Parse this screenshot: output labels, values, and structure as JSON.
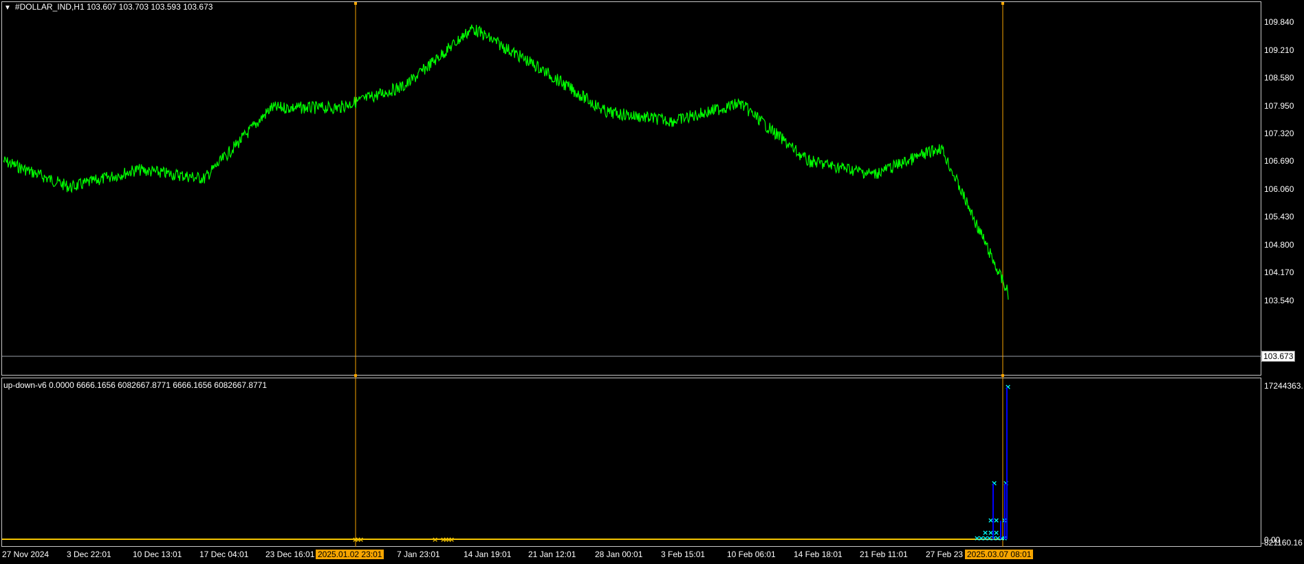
{
  "chart_data": [
    {
      "type": "line",
      "title": "#DOLLAR_IND,H1  103.607 103.703 103.593 103.673",
      "symbol": "#DOLLAR_IND",
      "timeframe": "H1",
      "ohlc": {
        "open": 103.607,
        "high": 103.703,
        "low": 103.593,
        "close": 103.673
      },
      "x": [
        "27 Nov 2024",
        "3 Dec 22:01",
        "10 Dec 13:01",
        "17 Dec 04:01",
        "23 Dec 16:01",
        "2025.01.02 23:01",
        "7 Jan 23:01",
        "14 Jan 19:01",
        "21 Jan 12:01",
        "28 Jan 00:01",
        "3 Feb 15:01",
        "10 Feb 06:01",
        "14 Feb 18:01",
        "21 Feb 11:01",
        "27 Feb 23",
        "2025.03.07 08:01"
      ],
      "series": [
        {
          "values": [
            106.7,
            106.1,
            106.5,
            106.3,
            107.9,
            107.9,
            108.4,
            109.7,
            108.8,
            107.8,
            107.6,
            108.0,
            106.7,
            106.4,
            107.0,
            103.7
          ]
        }
      ],
      "yticks": [
        "109.840",
        "109.210",
        "108.580",
        "107.950",
        "107.320",
        "106.690",
        "106.060",
        "105.430",
        "104.800",
        "104.170",
        "103.540"
      ],
      "ylim": [
        103.5,
        110.2
      ],
      "current_price": "103.673",
      "line_color": "#00ff00"
    },
    {
      "type": "line",
      "title": "up-down-v6 0.0000 6666.1656 6082667.8771 6666.1656 6082667.8771",
      "yticks_top": "17244363.",
      "yticks_bottom": [
        "0.00",
        "-821160.16"
      ],
      "series_colors": [
        "#f5c400",
        "#00ffff",
        "#0000ff"
      ]
    }
  ],
  "colors": {
    "vline": "#f7a500",
    "highlight_label": "#f7a500"
  }
}
